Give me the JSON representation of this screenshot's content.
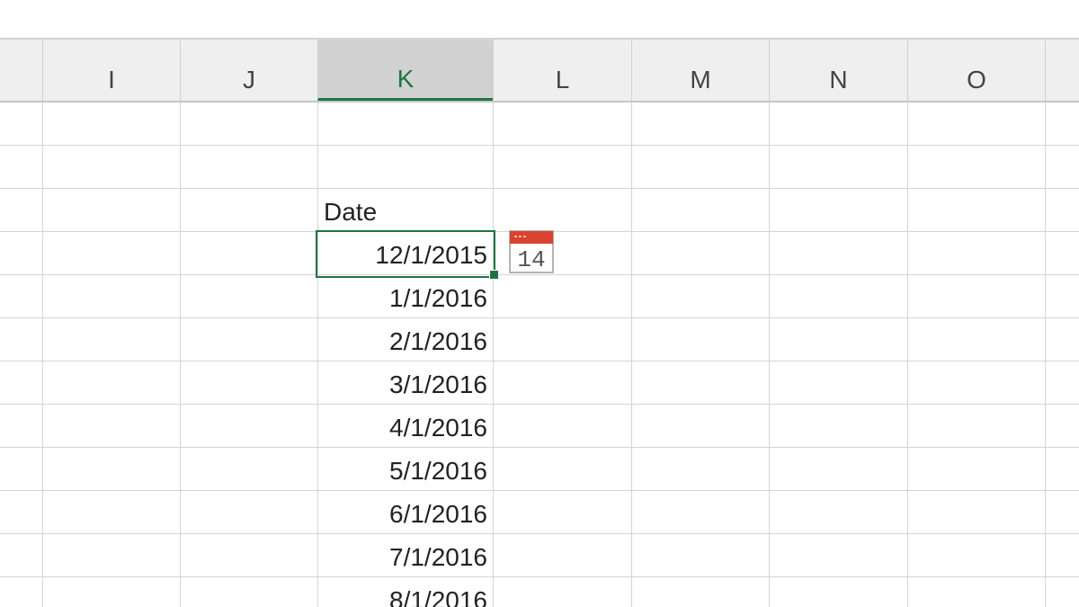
{
  "columns": {
    "i": "I",
    "j": "J",
    "k": "K",
    "l": "L",
    "m": "M",
    "n": "N",
    "o": "O"
  },
  "selected_column": "K",
  "header_text": "Date",
  "dates": [
    "12/1/2015",
    "1/1/2016",
    "2/1/2016",
    "3/1/2016",
    "4/1/2016",
    "5/1/2016",
    "6/1/2016",
    "7/1/2016",
    "8/1/2016"
  ],
  "date_icon": {
    "name": "calendar-icon",
    "day": "14"
  },
  "colors": {
    "accent": "#217346",
    "calendar_red": "#d9432f"
  }
}
